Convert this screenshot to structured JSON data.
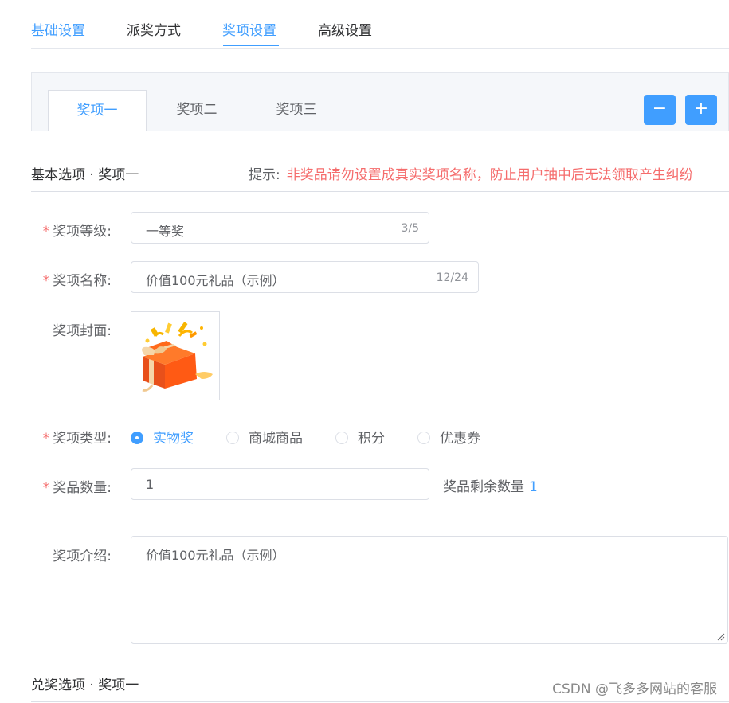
{
  "top_tabs": [
    "基础设置",
    "派奖方式",
    "奖项设置",
    "高级设置"
  ],
  "prize_tabs": [
    "奖项一",
    "奖项二",
    "奖项三"
  ],
  "prize_buttons": {
    "remove": "−",
    "add": "+"
  },
  "basic_section": {
    "title": "基本选项 · 奖项一",
    "hint_label": "提示:",
    "hint_text": "非奖品请勿设置成真实奖项名称，防止用户抽中后无法领取产生纠纷"
  },
  "form": {
    "level": {
      "label": "奖项等级:",
      "value": "一等奖",
      "count": "3/5"
    },
    "name": {
      "label": "奖项名称:",
      "value": "价值100元礼品（示例）",
      "count": "12/24"
    },
    "cover": {
      "label": "奖项封面:"
    },
    "type": {
      "label": "奖项类型:",
      "options": [
        "实物奖",
        "商城商品",
        "积分",
        "优惠券"
      ],
      "selected": "实物奖"
    },
    "quantity": {
      "label": "奖品数量:",
      "value": "1",
      "remain_label": "奖品剩余数量",
      "remain_value": "1"
    },
    "intro": {
      "label": "奖项介绍:",
      "value": "价值100元礼品（示例）"
    }
  },
  "redeem_section": {
    "title": "兑奖选项 · 奖项一"
  },
  "watermark": "CSDN @飞多多网站的客服",
  "colors": {
    "accent": "#409eff",
    "required": "#f56c6c",
    "border": "#dcdfe6"
  }
}
